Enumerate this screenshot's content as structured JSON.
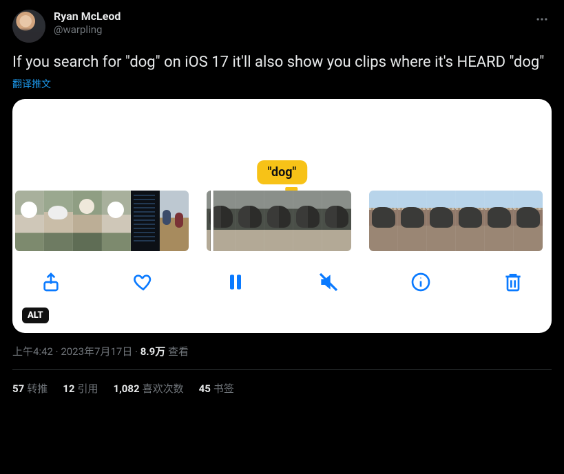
{
  "user": {
    "name": "Ryan McLeod",
    "handle": "@warpling"
  },
  "tweet_text": "If you search for \"dog\" on iOS 17 it'll also show you clips where it's HEARD \"dog\"",
  "translate_label": "翻译推文",
  "media": {
    "badge_text": "\"dog\"",
    "alt_label": "ALT"
  },
  "meta": {
    "time": "上午4:42",
    "date": "2023年7月17日",
    "views_count": "8.9万",
    "views_label": "查看"
  },
  "stats": {
    "retweets": {
      "count": "57",
      "label": "转推"
    },
    "quotes": {
      "count": "12",
      "label": "引用"
    },
    "likes": {
      "count": "1,082",
      "label": "喜欢次数"
    },
    "bookmarks": {
      "count": "45",
      "label": "书签"
    }
  }
}
